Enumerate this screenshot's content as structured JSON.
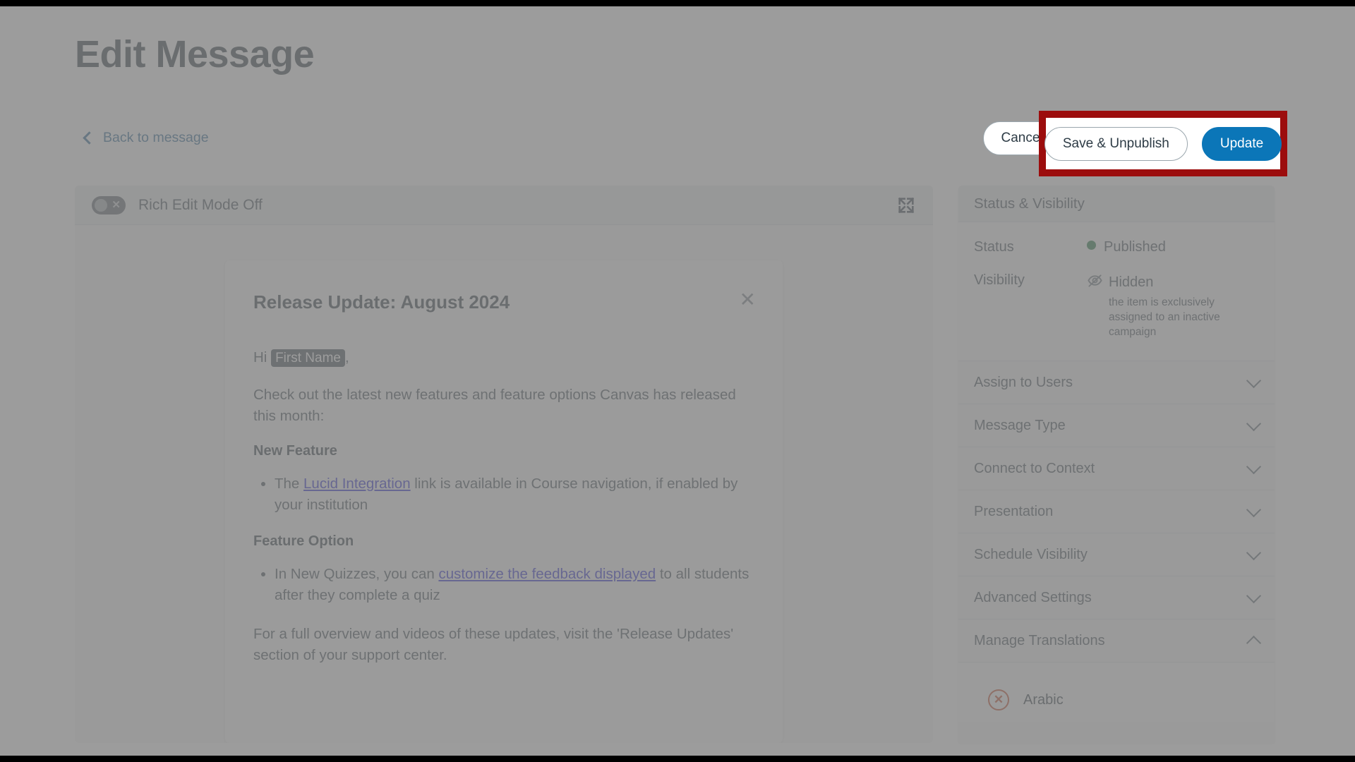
{
  "header": {
    "title": "Edit Message",
    "back_link": "Back to message",
    "back_icon": "chevron-left-icon"
  },
  "actions": {
    "cancel_label": "Cancel",
    "save_unpublish_label": "Save & Unpublish",
    "update_label": "Update",
    "highlight_color": "#9c0d0d",
    "primary_color": "#0b76b8"
  },
  "editor": {
    "toggle_label": "Rich Edit Mode Off",
    "toggle_state": "off",
    "toggle_icon": "toggle-off-icon",
    "expand_icon": "expand-fullscreen-icon"
  },
  "message": {
    "title": "Release Update: August 2024",
    "close_icon": "close-icon",
    "greeting_prefix": "Hi ",
    "greeting_token": "First Name",
    "greeting_suffix": ",",
    "intro": "Check out the latest new features and feature options Canvas has released this month:",
    "section_1_heading": "New Feature",
    "bullet_1_before": "The ",
    "bullet_1_link": "Lucid Integration",
    "bullet_1_after": " link is available in Course navigation, if enabled by your institution",
    "section_2_heading": "Feature Option",
    "bullet_2_before": "In New Quizzes, you can ",
    "bullet_2_link": "customize the feedback displayed",
    "bullet_2_after": " to all students after they complete a quiz",
    "closing": "For a full overview and videos of these updates, visit the 'Release Updates' section of your support center."
  },
  "sidebar": {
    "status_header": "Status & Visibility",
    "status_label": "Status",
    "status_value": "Published",
    "status_dot_color": "#0b6b2e",
    "visibility_label": "Visibility",
    "visibility_value": "Hidden",
    "visibility_icon": "eye-off-icon",
    "visibility_note": "the item is exclusively assigned to an inactive campaign",
    "sections": [
      {
        "label": "Assign to Users",
        "state": "collapsed",
        "icon": "chevron-down-icon"
      },
      {
        "label": "Message Type",
        "state": "collapsed",
        "icon": "chevron-down-icon"
      },
      {
        "label": "Connect to Context",
        "state": "collapsed",
        "icon": "chevron-down-icon"
      },
      {
        "label": "Presentation",
        "state": "collapsed",
        "icon": "chevron-down-icon"
      },
      {
        "label": "Schedule Visibility",
        "state": "collapsed",
        "icon": "chevron-down-icon"
      },
      {
        "label": "Advanced Settings",
        "state": "collapsed",
        "icon": "chevron-down-icon"
      },
      {
        "label": "Manage Translations",
        "state": "expanded",
        "icon": "chevron-up-icon"
      }
    ],
    "translations": [
      {
        "language": "Arabic",
        "status_icon": "x-circle-icon",
        "status_color": "#c03a12"
      }
    ]
  }
}
